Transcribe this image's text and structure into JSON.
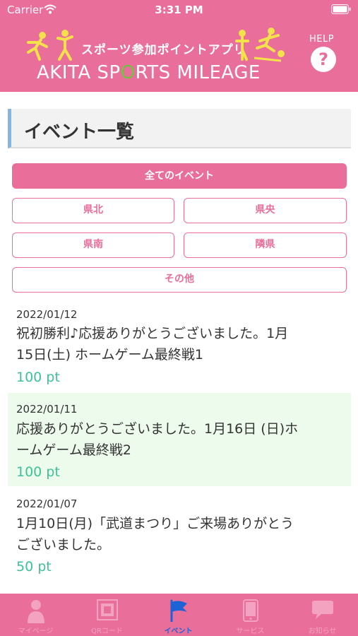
{
  "status_bar": {
    "carrier": "Carrier",
    "time": "3:31 PM"
  },
  "banner": {
    "subtitle": "スポーツ参加ポイントアプリ",
    "title_part1": "AKITA SP",
    "title_o": "O",
    "title_part2": "RTS MILEAGE",
    "help_label": "HELP",
    "help_symbol": "?"
  },
  "page": {
    "title": "イベント一覧"
  },
  "filters": {
    "all": "全てのイベント",
    "north": "県北",
    "central": "県央",
    "south": "県南",
    "neighbor": "隣県",
    "other": "その他"
  },
  "events": [
    {
      "date": "2022/01/12",
      "title_line1": "祝初勝利♪応援ありがとうございました。1月",
      "title_line2": "15日(土) ホームゲーム最終戦1",
      "points": "100 pt"
    },
    {
      "date": "2022/01/11",
      "title_line1": "応援ありがとうございました。1月16日 (日)ホ",
      "title_line2": "ームゲーム最終戦2",
      "points": "100 pt"
    },
    {
      "date": "2022/01/07",
      "title_line1": "1月10日(月)「武道まつり」ご来場ありがとう",
      "title_line2": "ございました。",
      "points": "50 pt"
    }
  ],
  "tabs": [
    {
      "label": "マイページ",
      "icon": "person-icon"
    },
    {
      "label": "QRコード",
      "icon": "qr-code-icon"
    },
    {
      "label": "イベント",
      "icon": "flag-icon"
    },
    {
      "label": "サービス",
      "icon": "phone-icon"
    },
    {
      "label": "お知らせ",
      "icon": "chat-bubble-icon"
    }
  ],
  "colors": {
    "brand_pink": "#ea6e9a",
    "points_green": "#3cc29a",
    "active_tab_blue": "#1e63d6",
    "highlight_row": "#ecfbec",
    "title_accent": "#7fb7e6"
  }
}
